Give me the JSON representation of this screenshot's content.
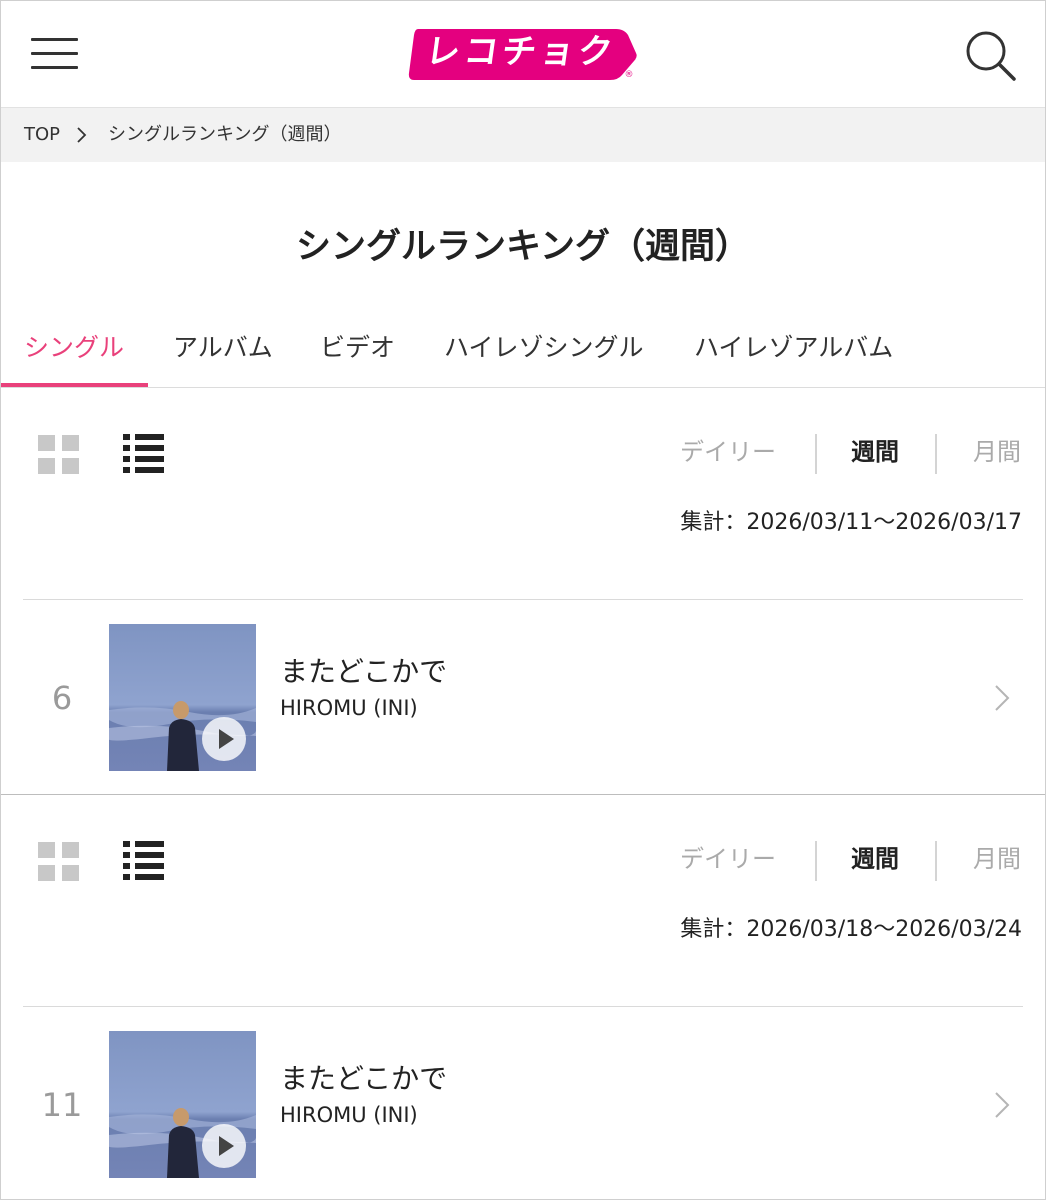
{
  "header": {
    "logo_text": "レコチョク",
    "logo_mark": "®",
    "logo_color": "#e4007f",
    "menu_icon": "hamburger-icon",
    "search_icon": "search-icon"
  },
  "breadcrumb": {
    "top": "TOP",
    "current": "シングルランキング（週間）"
  },
  "page_title": "シングルランキング（週間）",
  "tabs": [
    {
      "label": "シングル",
      "active": true
    },
    {
      "label": "アルバム",
      "active": false
    },
    {
      "label": "ビデオ",
      "active": false
    },
    {
      "label": "ハイレゾシングル",
      "active": false
    },
    {
      "label": "ハイレゾアルバム",
      "active": false
    }
  ],
  "accent_color": "#e9417b",
  "sections": [
    {
      "view_icons": [
        "grid-view-icon",
        "list-view-icon"
      ],
      "periods": {
        "daily": "デイリー",
        "weekly": "週間",
        "monthly": "月間"
      },
      "selected_period": "weekly",
      "aggregation": "集計：2026/03/11〜2026/03/17",
      "item": {
        "rank": "6",
        "title": "またどこかで",
        "artist": "HIROMU (INI)"
      }
    },
    {
      "view_icons": [
        "grid-view-icon",
        "list-view-icon"
      ],
      "periods": {
        "daily": "デイリー",
        "weekly": "週間",
        "monthly": "月間"
      },
      "selected_period": "weekly",
      "aggregation": "集計：2026/03/18〜2026/03/24",
      "item": {
        "rank": "11",
        "title": "またどこかで",
        "artist": "HIROMU (INI)"
      }
    }
  ]
}
